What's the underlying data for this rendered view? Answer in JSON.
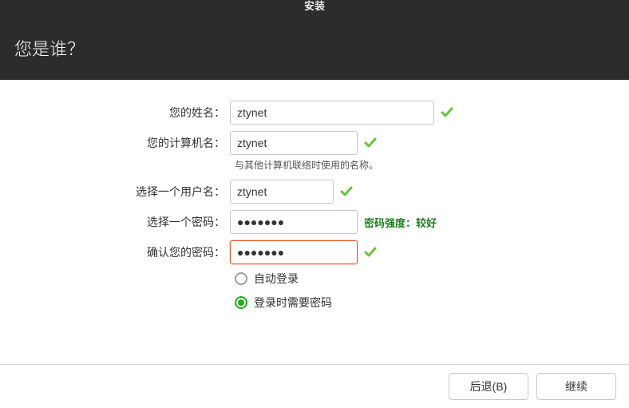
{
  "window": {
    "title": "安装"
  },
  "header": {
    "title": "您是谁？"
  },
  "form": {
    "name": {
      "label": "您的姓名：",
      "value": "ztynet"
    },
    "hostname": {
      "label": "您的计算机名：",
      "value": "ztynet",
      "hint": "与其他计算机联络时使用的名称。"
    },
    "username": {
      "label": "选择一个用户名：",
      "value": "ztynet"
    },
    "password": {
      "label": "选择一个密码：",
      "value": "●●●●●●●",
      "strength": "密码强度：较好"
    },
    "confirm": {
      "label": "确认您的密码：",
      "value": "●●●●●●●"
    },
    "login": {
      "auto": "自动登录",
      "require": "登录时需要密码"
    }
  },
  "buttons": {
    "back": "后退(B)",
    "continue": "继续"
  }
}
